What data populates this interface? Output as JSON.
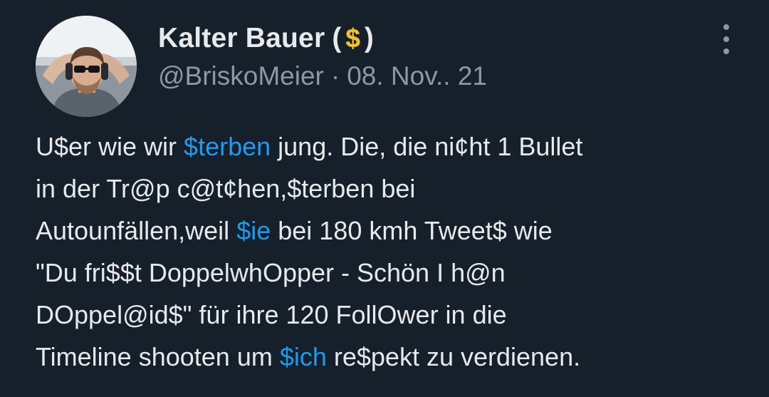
{
  "tweet": {
    "author": {
      "display_name": "Kalter Bauer",
      "name_open_paren": "(",
      "name_emoji": "$",
      "name_close_paren": ")",
      "handle": "@BriskoMeier",
      "separator": "·",
      "date": "08. Nov.. 21"
    },
    "menu_icon": "more-vertical-icon",
    "colors": {
      "background": "#15202b",
      "text": "#e7e9ea",
      "secondary_text": "#8b98a5",
      "link": "#1d9bf0",
      "emoji": "#f2c230"
    },
    "lines": [
      [
        {
          "text": "U$er wie wir "
        },
        {
          "text": "$terben",
          "link": true
        },
        {
          "text": " jung. Die, die ni¢ht 1 Bullet"
        }
      ],
      [
        {
          "text": "in der Tr@p c@t¢hen,$terben bei"
        }
      ],
      [
        {
          "text": "Autounfällen,weil "
        },
        {
          "text": "$ie",
          "link": true
        },
        {
          "text": " bei 180 kmh Tweet$ wie"
        }
      ],
      [
        {
          "text": "\"Du fri$$t DoppelwhOpper - Schön I h@n"
        }
      ],
      [
        {
          "text": "DOppel@id$\" für ihre 120 FollOwer in die"
        }
      ],
      [
        {
          "text": "Timeline shooten um "
        },
        {
          "text": "$ich",
          "link": true
        },
        {
          "text": " re$pekt zu verdienen."
        }
      ]
    ]
  }
}
